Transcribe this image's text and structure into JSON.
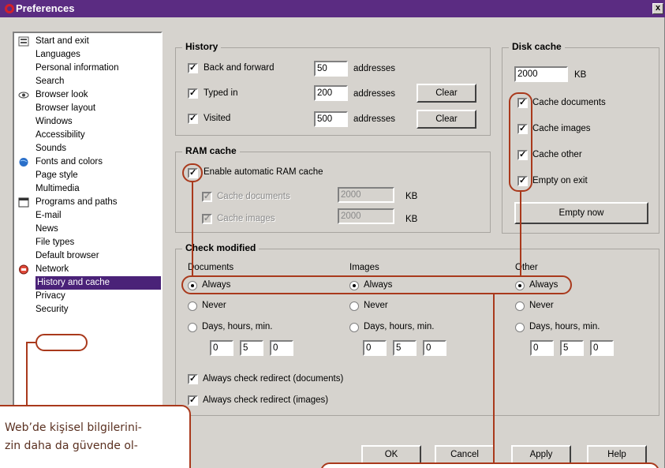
{
  "window": {
    "title": "Preferences",
    "close_glyph": "x"
  },
  "sidebar": {
    "items": [
      {
        "label": "Start and exit",
        "icon": "start-exit-icon"
      },
      {
        "label": "Languages"
      },
      {
        "label": "Personal information"
      },
      {
        "label": "Search"
      },
      {
        "label": "Browser look",
        "icon": "eye-icon"
      },
      {
        "label": "Browser layout"
      },
      {
        "label": "Windows"
      },
      {
        "label": "Accessibility"
      },
      {
        "label": "Sounds"
      },
      {
        "label": "Fonts and colors",
        "icon": "globe-icon"
      },
      {
        "label": "Page style"
      },
      {
        "label": "Multimedia"
      },
      {
        "label": "Programs and paths",
        "icon": "programs-icon"
      },
      {
        "label": "E-mail"
      },
      {
        "label": "News"
      },
      {
        "label": "File types"
      },
      {
        "label": "Default browser"
      },
      {
        "label": "Network",
        "icon": "network-icon"
      },
      {
        "label": "History and cache",
        "selected": true
      },
      {
        "label": "Privacy"
      },
      {
        "label": "Security"
      }
    ]
  },
  "history": {
    "title": "History",
    "back_forward": {
      "label": "Back and forward",
      "checked": true,
      "value": "50",
      "unit": "addresses"
    },
    "typed_in": {
      "label": "Typed in",
      "checked": true,
      "value": "200",
      "unit": "addresses",
      "clear": "Clear"
    },
    "visited": {
      "label": "Visited",
      "checked": true,
      "value": "500",
      "unit": "addresses",
      "clear": "Clear"
    }
  },
  "ram_cache": {
    "title": "RAM cache",
    "enable": {
      "label": "Enable automatic RAM cache",
      "checked": true
    },
    "documents": {
      "label": "Cache documents",
      "value": "2000",
      "unit": "KB"
    },
    "images": {
      "label": "Cache images",
      "value": "2000",
      "unit": "KB"
    }
  },
  "disk_cache": {
    "title": "Disk cache",
    "size": "2000",
    "unit": "KB",
    "documents": "Cache documents",
    "images": "Cache images",
    "other": "Cache other",
    "empty_on_exit": "Empty on exit",
    "empty_now": "Empty now"
  },
  "check_modified": {
    "title": "Check modified",
    "columns": [
      {
        "header": "Documents",
        "always": "Always",
        "never": "Never",
        "days": "Days, hours, min.",
        "d": "0",
        "h": "5",
        "m": "0"
      },
      {
        "header": "Images",
        "always": "Always",
        "never": "Never",
        "days": "Days, hours, min.",
        "d": "0",
        "h": "5",
        "m": "0"
      },
      {
        "header": "Other",
        "always": "Always",
        "never": "Never",
        "days": "Days, hours, min.",
        "d": "0",
        "h": "5",
        "m": "0"
      }
    ],
    "redirect_docs": "Always check redirect (documents)",
    "redirect_images": "Always check redirect (images)"
  },
  "buttons": {
    "ok": "OK",
    "cancel": "Cancel",
    "apply": "Apply",
    "help": "Help"
  },
  "callout": {
    "line1": "Web’de kişisel bilgilerini-",
    "line2": "zin daha da güvende ol-"
  },
  "colors": {
    "titlebar": "#5b2c82",
    "selection": "#4a2278",
    "annotation": "#a9391c"
  }
}
